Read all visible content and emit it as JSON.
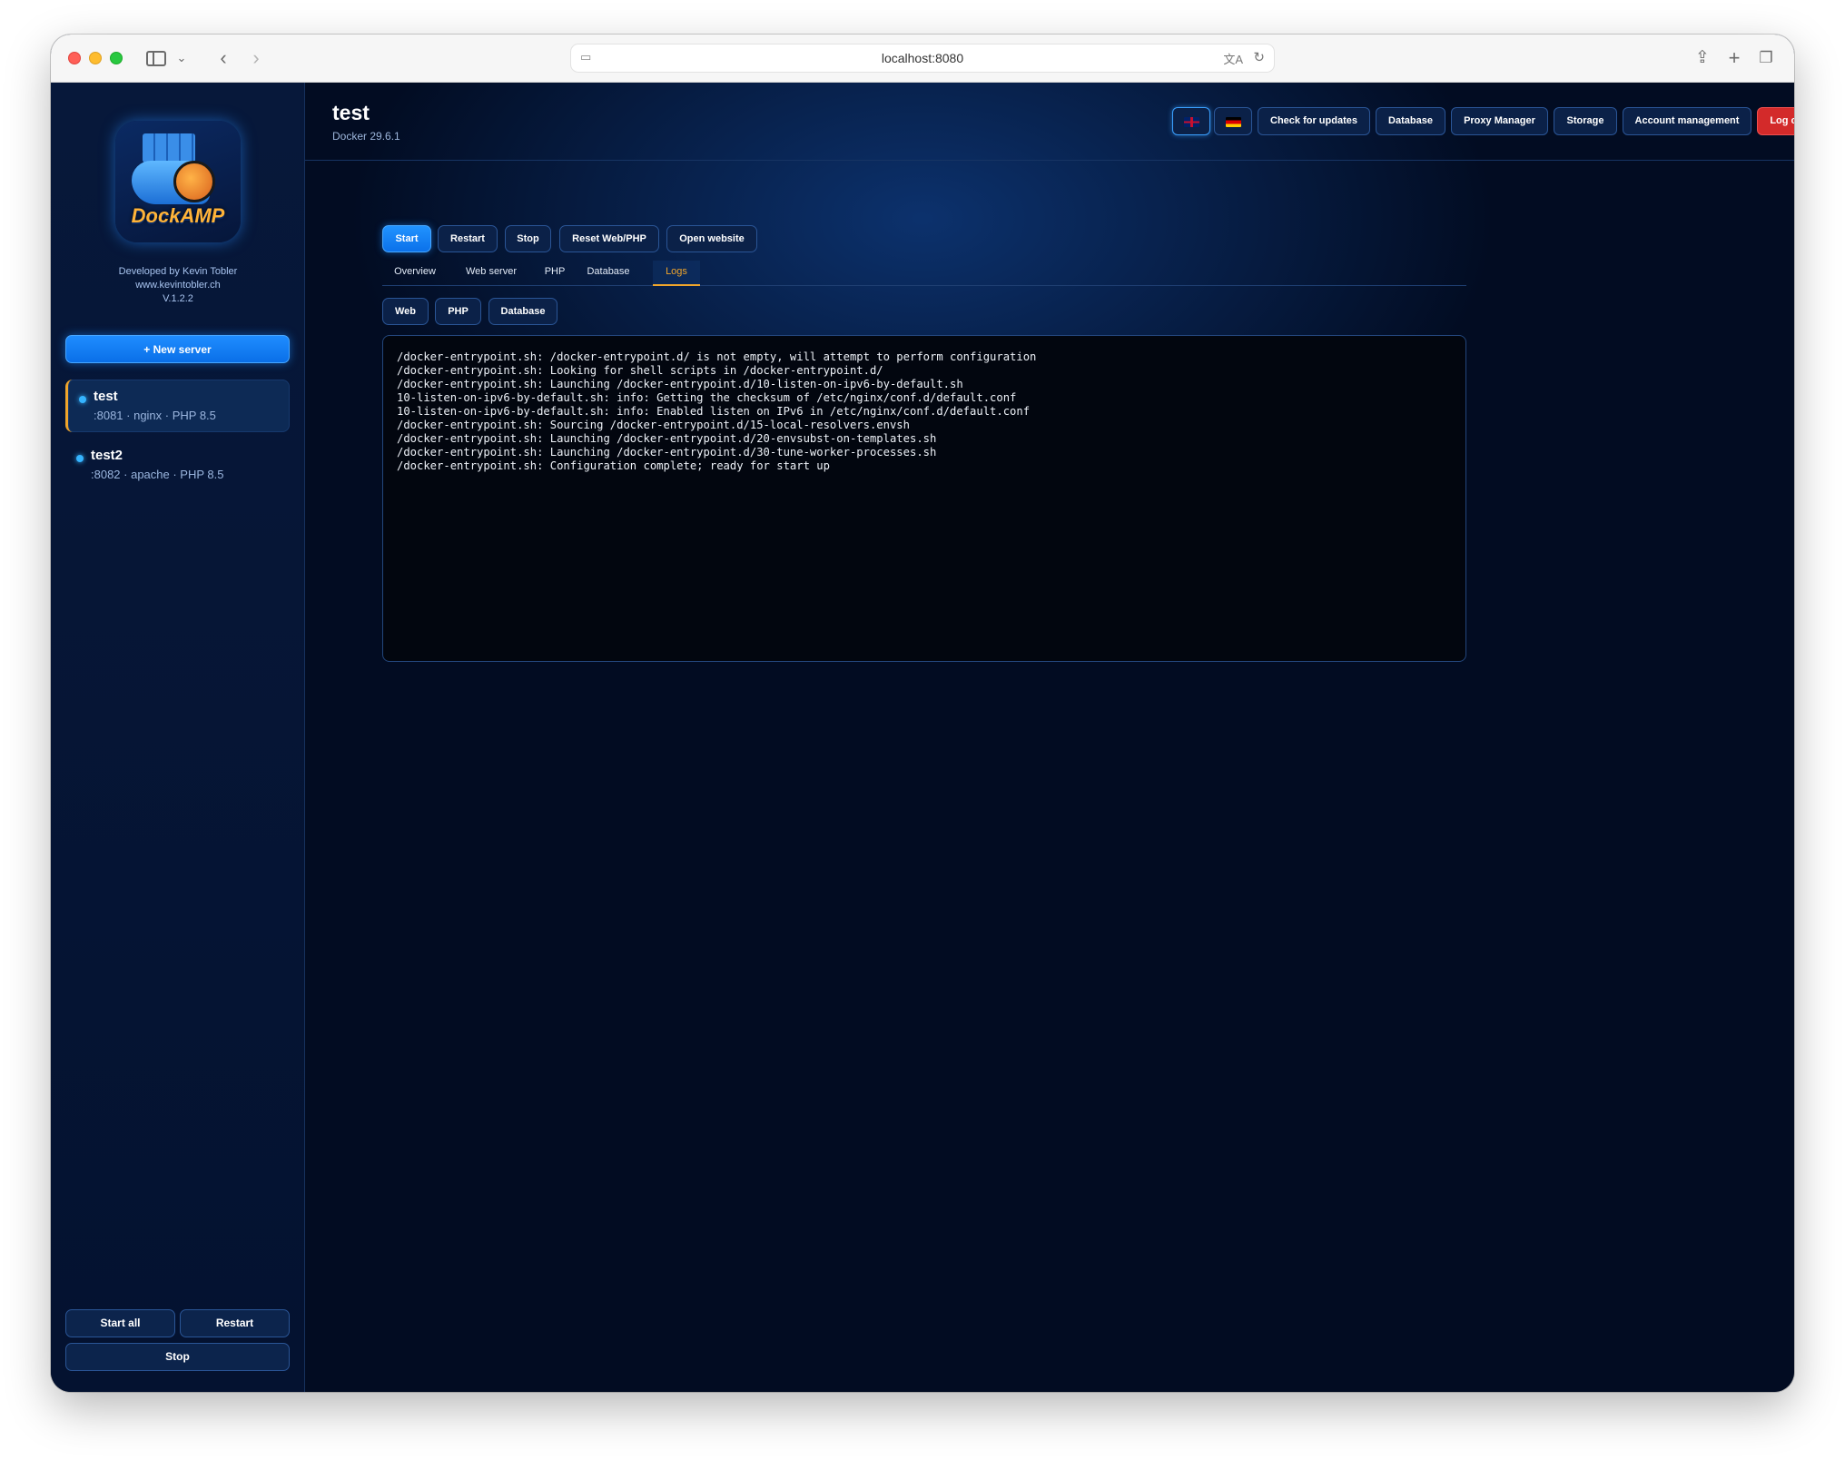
{
  "browser": {
    "url": "localhost:8080",
    "icons": [
      "sidebar-toggle-icon",
      "chevron-down-icon",
      "back-icon",
      "forward-icon",
      "page-icon",
      "translate-icon",
      "reload-icon",
      "share-icon",
      "new-tab-icon",
      "tabs-overview-icon"
    ]
  },
  "sidebar": {
    "logo_text": "DockAMP",
    "developer": "Developed by Kevin Tobler",
    "website": "www.kevintobler.ch",
    "version": "V.1.2.2",
    "new_server_label": "+ New server",
    "servers": [
      {
        "name": "test",
        "meta": ":8081 · nginx · PHP 8.5",
        "active": true
      },
      {
        "name": "test2",
        "meta": ":8082 · apache · PHP 8.5",
        "active": false
      }
    ],
    "start_all_label": "Start all",
    "restart_label": "Restart",
    "stop_label": "Stop"
  },
  "header": {
    "title": "test",
    "docker_version": "Docker 29.6.1",
    "languages": [
      "en",
      "de"
    ],
    "selected_language": "en",
    "buttons": {
      "check_updates": "Check for updates",
      "database": "Database",
      "proxy_manager": "Proxy Manager",
      "storage": "Storage",
      "account_management": "Account management",
      "logout": "Log out"
    }
  },
  "actions": {
    "start": "Start",
    "restart": "Restart",
    "stop": "Stop",
    "reset": "Reset Web/PHP",
    "open_website": "Open website"
  },
  "tabs": [
    {
      "label": "Overview",
      "active": false
    },
    {
      "label": "Web server",
      "active": false
    },
    {
      "label": "PHP",
      "active": false
    },
    {
      "label": "Database",
      "active": false
    },
    {
      "label": "Logs",
      "active": true
    }
  ],
  "log_sources": [
    "Web",
    "PHP",
    "Database"
  ],
  "logs": [
    "/docker-entrypoint.sh: /docker-entrypoint.d/ is not empty, will attempt to perform configuration",
    "/docker-entrypoint.sh: Looking for shell scripts in /docker-entrypoint.d/",
    "/docker-entrypoint.sh: Launching /docker-entrypoint.d/10-listen-on-ipv6-by-default.sh",
    "10-listen-on-ipv6-by-default.sh: info: Getting the checksum of /etc/nginx/conf.d/default.conf",
    "10-listen-on-ipv6-by-default.sh: info: Enabled listen on IPv6 in /etc/nginx/conf.d/default.conf",
    "/docker-entrypoint.sh: Sourcing /docker-entrypoint.d/15-local-resolvers.envsh",
    "/docker-entrypoint.sh: Launching /docker-entrypoint.d/20-envsubst-on-templates.sh",
    "/docker-entrypoint.sh: Launching /docker-entrypoint.d/30-tune-worker-processes.sh",
    "/docker-entrypoint.sh: Configuration complete; ready for start up"
  ],
  "colors": {
    "accent": "#1e8cff",
    "active_tab": "#f0a52b",
    "logout": "#d32a2a",
    "background": "#03112a"
  }
}
